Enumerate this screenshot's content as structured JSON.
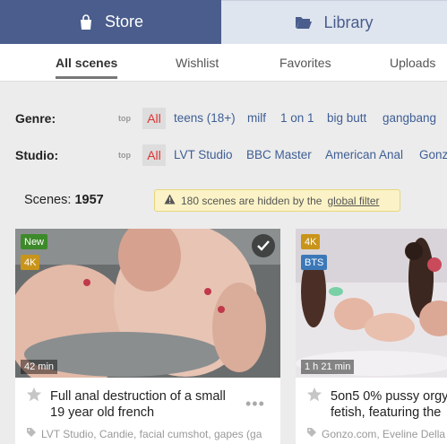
{
  "top_tabs": {
    "store": "Store",
    "library": "Library"
  },
  "subnav": [
    "All scenes",
    "Wishlist",
    "Favorites",
    "Uploads"
  ],
  "filters": {
    "top_label": "top",
    "all_label": "All",
    "genre": {
      "label": "Genre:",
      "tags": [
        "teens (18+)",
        "milf",
        "1 on 1",
        "big butt",
        "gangbang"
      ]
    },
    "studio": {
      "label": "Studio:",
      "tags": [
        "LVT Studio",
        "BBC Master",
        "American Anal",
        "Gonzo"
      ]
    }
  },
  "scenes": {
    "count_label": "Scenes:",
    "count": "1957",
    "notice_text": "180 scenes are hidden by the",
    "notice_link": "global filter"
  },
  "cards": [
    {
      "badges": [
        "New",
        "4K"
      ],
      "duration": "42 min",
      "title": "Full anal destruction of a small 19 year old french",
      "tags": "LVT Studio, Candie, facial cumshot, gapes (ga"
    },
    {
      "badges": [
        "4K",
        "BTS"
      ],
      "duration": "1 h 21 min",
      "title": "5on5 0% pussy orgy fetish, featuring the",
      "tags": "Gonzo.com, Eveline Della"
    }
  ],
  "colors": {
    "store_bg": "#4a5d8c",
    "accent_red": "#d33333",
    "tag_blue": "#3e5e95"
  }
}
